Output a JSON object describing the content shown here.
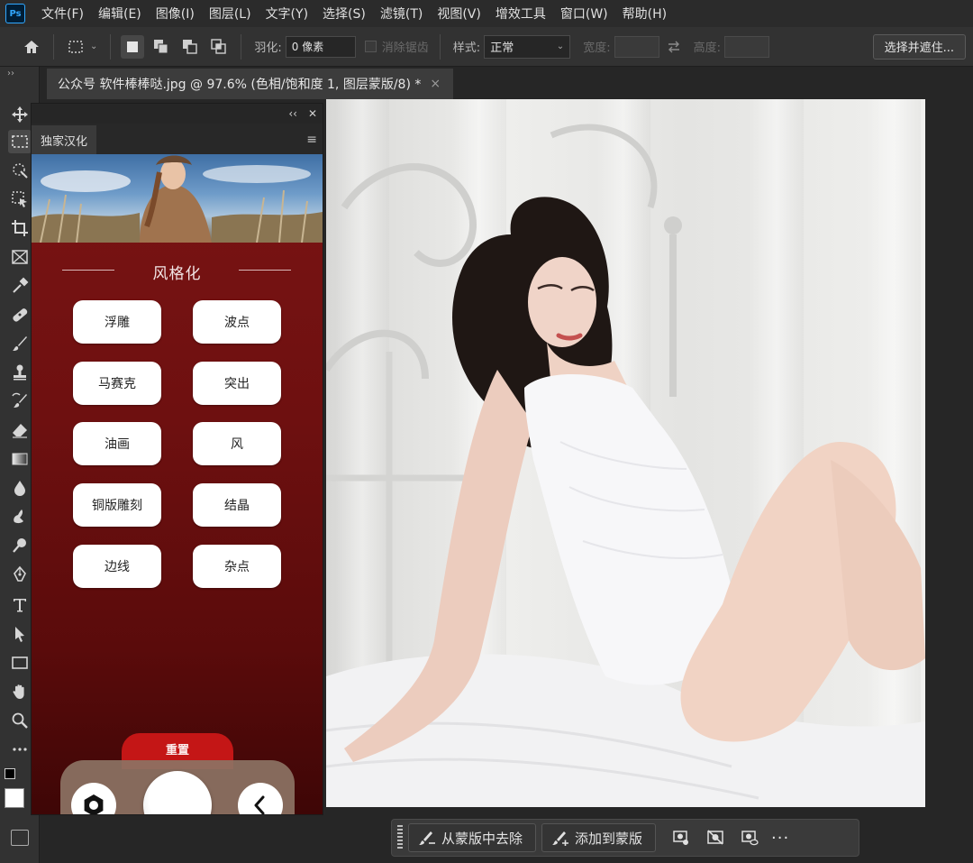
{
  "app": {
    "logo": "Ps"
  },
  "menu": [
    "文件(F)",
    "编辑(E)",
    "图像(I)",
    "图层(L)",
    "文字(Y)",
    "选择(S)",
    "滤镜(T)",
    "视图(V)",
    "增效工具",
    "窗口(W)",
    "帮助(H)"
  ],
  "options": {
    "feather_label": "羽化:",
    "feather_value": "0 像素",
    "antialias_label": "消除锯齿",
    "style_label": "样式:",
    "style_value": "正常",
    "width_label": "宽度:",
    "height_label": "高度:",
    "select_mask_button": "选择并遮住..."
  },
  "document": {
    "tab_title": "公众号 软件棒棒哒.jpg @ 97.6% (色相/饱和度 1, 图层蒙版/8) *",
    "close_glyph": "×"
  },
  "panel": {
    "collapse_glyph": "‹‹",
    "close_glyph": "✕",
    "tab_label": "独家汉化",
    "menu_glyph": "≡",
    "section_title": "风格化",
    "buttons": [
      "浮雕",
      "波点",
      "马赛克",
      "突出",
      "油画",
      "风",
      "铜版雕刻",
      "结晶",
      "边线",
      "杂点"
    ],
    "reset_label": "重置"
  },
  "contextbar": {
    "remove_from_mask": "从蒙版中去除",
    "add_to_mask": "添加到蒙版",
    "more_glyph": "···"
  },
  "icons": {
    "toolbar": [
      "move-icon",
      "marquee-icon",
      "quick-select-icon",
      "object-select-icon",
      "crop-icon",
      "frame-icon",
      "eyedropper-icon",
      "healing-icon",
      "brush-icon",
      "stamp-icon",
      "history-brush-icon",
      "eraser-icon",
      "gradient-icon",
      "blur-icon",
      "smudge-icon",
      "dodge-icon",
      "pen-icon",
      "type-icon",
      "path-select-icon",
      "rectangle-icon",
      "hand-icon",
      "zoom-icon",
      "more-tools-icon"
    ]
  }
}
